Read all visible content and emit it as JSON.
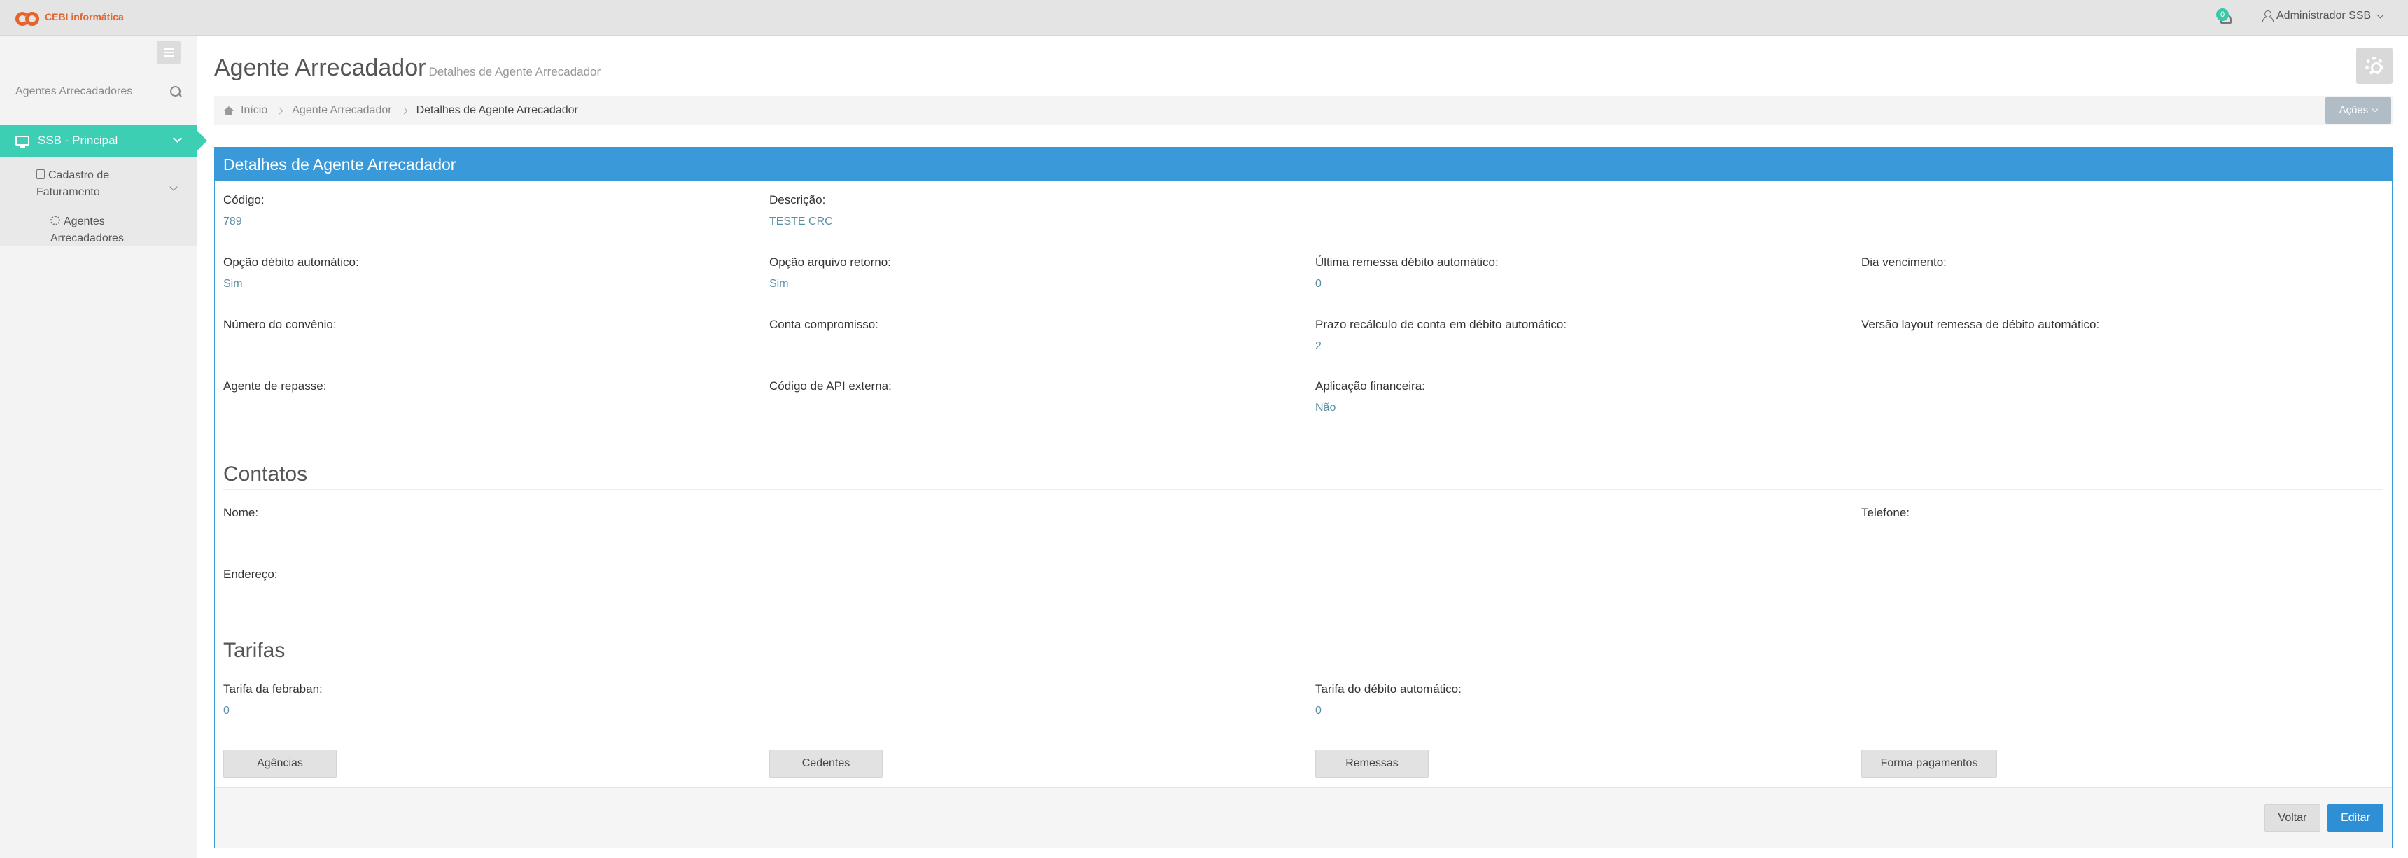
{
  "app": {
    "logo_text": "CEBI informática",
    "notification_count": "0",
    "user_name": "Administrador SSB"
  },
  "sidebar": {
    "search_placeholder": "Agentes Arrecadadores",
    "main_item": "SSB - Principal",
    "sub_item": "Cadastro de Faturamento",
    "leaf_item": "Agentes Arrecadadores"
  },
  "header": {
    "title": "Agente Arrecadador",
    "subtitle": "Detalhes de Agente Arrecadador",
    "breadcrumb": [
      "Início",
      "Agente Arrecadador",
      "Detalhes de Agente Arrecadador"
    ],
    "actions_label": "Ações"
  },
  "panel": {
    "title": "Detalhes de Agente Arrecadador",
    "fields": {
      "codigo": {
        "label": "Código:",
        "value": "789"
      },
      "descricao": {
        "label": "Descrição:",
        "value": "TESTE CRC"
      },
      "opcao_debito": {
        "label": "Opção débito automático:",
        "value": "Sim"
      },
      "opcao_arquivo": {
        "label": "Opção arquivo retorno:",
        "value": "Sim"
      },
      "ultima_remessa": {
        "label": "Última remessa débito automático:",
        "value": "0"
      },
      "dia_vencimento": {
        "label": "Dia vencimento:",
        "value": ""
      },
      "numero_convenio": {
        "label": "Número do convênio:",
        "value": ""
      },
      "conta_compromisso": {
        "label": "Conta compromisso:",
        "value": ""
      },
      "prazo_recalculo": {
        "label": "Prazo recálculo de conta em débito automático:",
        "value": "2"
      },
      "versao_layout": {
        "label": "Versão layout remessa de débito automático:",
        "value": ""
      },
      "agente_repasse": {
        "label": "Agente de repasse:",
        "value": ""
      },
      "codigo_api": {
        "label": "Código de API externa:",
        "value": ""
      },
      "aplicacao_financeira": {
        "label": "Aplicação financeira:",
        "value": "Não"
      }
    },
    "contatos": {
      "title": "Contatos",
      "nome": {
        "label": "Nome:",
        "value": ""
      },
      "telefone": {
        "label": "Telefone:",
        "value": ""
      },
      "endereco": {
        "label": "Endereço:",
        "value": ""
      }
    },
    "tarifas": {
      "title": "Tarifas",
      "febraban": {
        "label": "Tarifa da febraban:",
        "value": "0"
      },
      "debito": {
        "label": "Tarifa do débito automático:",
        "value": "0"
      }
    },
    "buttons": [
      "Agências",
      "Cedentes",
      "Remessas",
      "Forma pagamentos"
    ],
    "footer": {
      "back": "Voltar",
      "edit": "Editar"
    }
  },
  "colors": {
    "accent_teal": "#3ccfb4",
    "primary_blue": "#3a9ad9",
    "brand_orange": "#e8632b"
  }
}
